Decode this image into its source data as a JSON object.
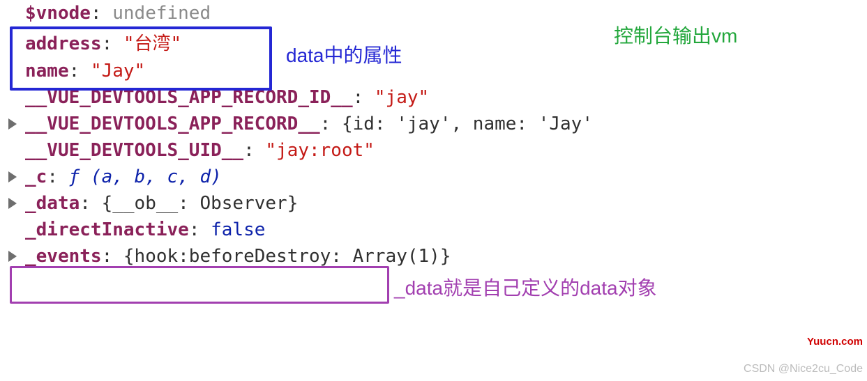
{
  "annotations": {
    "blue_label": "data中的属性",
    "green_label": "控制台输出vm",
    "purple_label": "_data就是自己定义的data对象"
  },
  "watermarks": {
    "red": "Yuucn.com",
    "gray": "CSDN @Nice2cu_Code"
  },
  "props": {
    "vnode": {
      "key": "$vnode",
      "value": "undefined"
    },
    "address": {
      "key": "address",
      "value": "\"台湾\""
    },
    "name": {
      "key": "name",
      "value": "\"Jay\""
    },
    "devtools_app_record_id": {
      "key": "__VUE_DEVTOOLS_APP_RECORD_ID__",
      "value": "\"jay\""
    },
    "devtools_app_record": {
      "key": "__VUE_DEVTOOLS_APP_RECORD__",
      "value": "{id: 'jay', name: 'Jay'"
    },
    "devtools_uid": {
      "key": "__VUE_DEVTOOLS_UID__",
      "value": "\"jay:root\""
    },
    "c_func": {
      "key": "_c",
      "value": "ƒ (a, b, c, d)"
    },
    "data": {
      "key": "_data",
      "value": "{__ob__: Observer}"
    },
    "directInactive": {
      "key": "_directInactive",
      "value": "false"
    },
    "events": {
      "key": "_events",
      "value": "{hook:beforeDestroy: Array(1)}"
    }
  }
}
